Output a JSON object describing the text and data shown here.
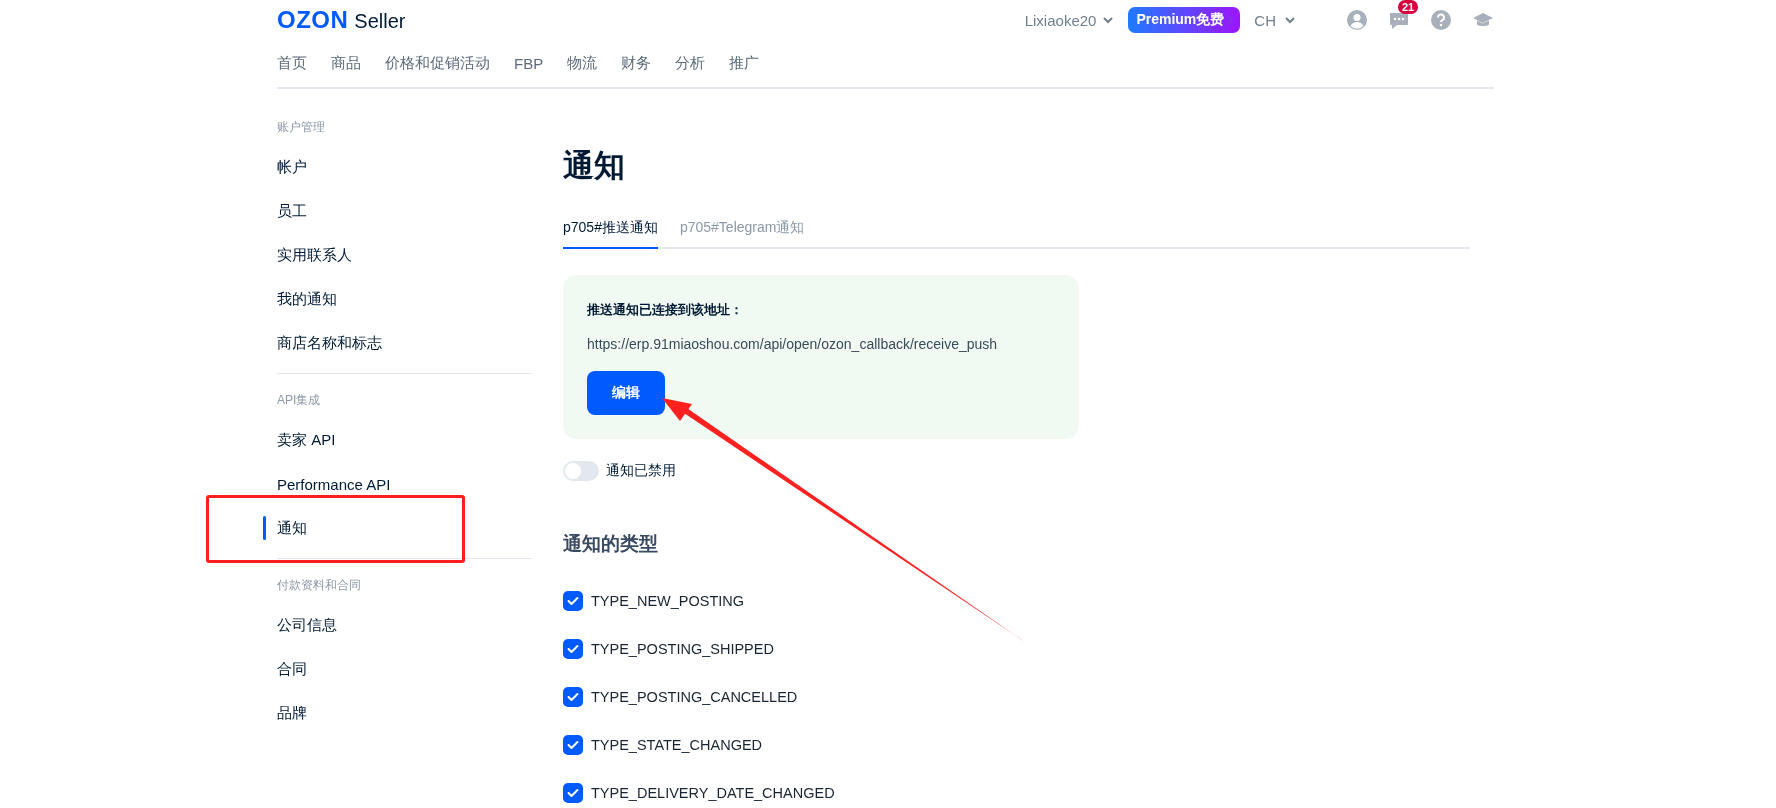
{
  "header": {
    "logo": "OZON",
    "logo_suffix": "Seller",
    "account": "Lixiaoke20",
    "premium": "Premium免费",
    "language": "CH",
    "message_count": "21"
  },
  "nav": [
    {
      "label": "首页"
    },
    {
      "label": "商品"
    },
    {
      "label": "价格和促销活动"
    },
    {
      "label": "FBP"
    },
    {
      "label": "物流"
    },
    {
      "label": "财务"
    },
    {
      "label": "分析"
    },
    {
      "label": "推广"
    }
  ],
  "sidebar": {
    "sections": [
      {
        "title": "账户管理",
        "items": [
          {
            "label": "帐户",
            "selected": false
          },
          {
            "label": "员工",
            "selected": false
          },
          {
            "label": "实用联系人",
            "selected": false
          },
          {
            "label": "我的通知",
            "selected": false
          },
          {
            "label": "商店名称和标志",
            "selected": false
          }
        ]
      },
      {
        "title": "API集成",
        "items": [
          {
            "label": "卖家 API",
            "selected": false
          },
          {
            "label": "Performance API",
            "selected": false
          },
          {
            "label": "通知",
            "selected": true
          }
        ]
      },
      {
        "title": "付款资料和合同",
        "items": [
          {
            "label": "公司信息",
            "selected": false
          },
          {
            "label": "合同",
            "selected": false
          },
          {
            "label": "品牌",
            "selected": false
          }
        ]
      }
    ]
  },
  "page": {
    "title": "通知",
    "tabs": [
      {
        "label": "p705#推送通知",
        "selected": true
      },
      {
        "label": "p705#Telegram通知",
        "selected": false
      }
    ],
    "connection_card": {
      "title": "推送通知已连接到该地址：",
      "url": "https://erp.91miaoshou.com/api/open/ozon_callback/receive_push",
      "button": "编辑"
    },
    "toggle": {
      "label": "通知已禁用",
      "on": false
    },
    "types_title": "通知的类型",
    "types": [
      {
        "label": "TYPE_NEW_POSTING",
        "checked": true
      },
      {
        "label": "TYPE_POSTING_SHIPPED",
        "checked": true
      },
      {
        "label": "TYPE_POSTING_CANCELLED",
        "checked": true
      },
      {
        "label": "TYPE_STATE_CHANGED",
        "checked": true
      },
      {
        "label": "TYPE_DELIVERY_DATE_CHANGED",
        "checked": true
      }
    ]
  }
}
